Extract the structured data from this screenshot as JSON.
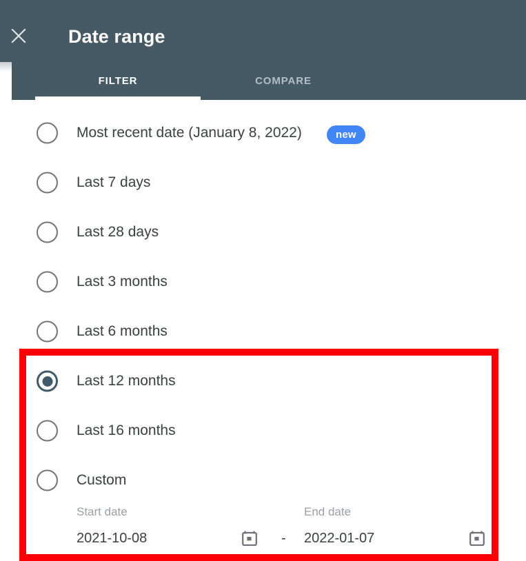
{
  "header": {
    "title": "Date range",
    "close_icon": "close-icon",
    "background_color": "#455a64",
    "tabs": [
      {
        "label": "FILTER",
        "selected": true
      },
      {
        "label": "COMPARE",
        "selected": false
      }
    ]
  },
  "options": [
    {
      "label": "Most recent date (January 8, 2022)",
      "selected": false,
      "badge": "new"
    },
    {
      "label": "Last 7 days",
      "selected": false
    },
    {
      "label": "Last 28 days",
      "selected": false
    },
    {
      "label": "Last 3 months",
      "selected": false
    },
    {
      "label": "Last 6 months",
      "selected": false
    },
    {
      "label": "Last 12 months",
      "selected": true
    },
    {
      "label": "Last 16 months",
      "selected": false
    },
    {
      "label": "Custom",
      "selected": false
    }
  ],
  "custom_range": {
    "start": {
      "caption": "Start date",
      "value": "2021-10-08",
      "icon": "calendar-icon"
    },
    "separator": "-",
    "end": {
      "caption": "End date",
      "value": "2022-01-07",
      "icon": "calendar-icon"
    }
  },
  "annotation": {
    "highlight_color": "#fb0007"
  },
  "colors": {
    "badge": "#4285f4",
    "selected_radio": "#3f5a69",
    "header": "#455a64"
  }
}
